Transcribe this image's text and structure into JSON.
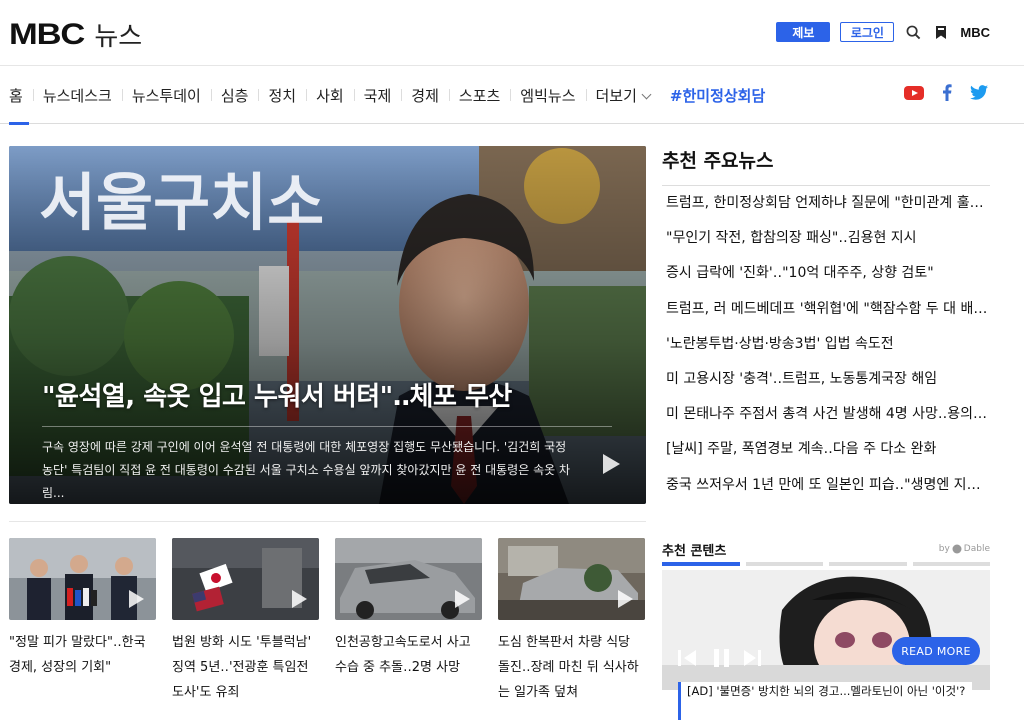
{
  "header": {
    "logo_brand": "MBC",
    "logo_section": "뉴스",
    "tip_button": "제보",
    "login_button": "로그인",
    "mbc_link": "MBC",
    "accent_color": "#2c63e8"
  },
  "nav": {
    "items": [
      {
        "label": "홈"
      },
      {
        "label": "뉴스데스크"
      },
      {
        "label": "뉴스투데이"
      },
      {
        "label": "심층"
      },
      {
        "label": "정치"
      },
      {
        "label": "사회"
      },
      {
        "label": "국제"
      },
      {
        "label": "경제"
      },
      {
        "label": "스포츠"
      },
      {
        "label": "엠빅뉴스"
      },
      {
        "label": "더보기"
      }
    ],
    "special_label": "#한미정상회담",
    "social": [
      "youtube-icon",
      "facebook-icon",
      "twitter-icon"
    ]
  },
  "hero": {
    "sign_text": "서울구치소",
    "title": "\"윤석열, 속옷 입고 누워서 버텨\"‥체포 무산",
    "description": "구속 영장에 따른 강제 구인에 이어 윤석열 전 대통령에 대한 체포영장 집행도 무산됐습니다. '김건희 국정농단' 특검팀이 직접 윤 전 대통령이 수감된 서울 구치소 수용실 앞까지 찾아갔지만 윤 전 대통령은 속옷 차림..."
  },
  "recommended_news": {
    "title": "추천 주요뉴스",
    "items": [
      "트럼프, 한미정상회담 언제하냐 질문에 \"한미관계 훌륭...",
      "\"무인기 작전, 합참의장 패싱\"‥김용현 지시",
      "증시 급락에 '진화'‥\"10억 대주주, 상향 검토\"",
      "트럼프, 러 메드베데프 '핵위협'에 \"핵잠수함 두 대 배치...",
      "'노란봉투법·상법·방송3법' 입법 속도전",
      "미 고용시장 '충격'‥트럼프, 노동통계국장 해임",
      "미 몬태나주 주점서 총격 사건 발생해 4명 사망‥용의자...",
      "[날씨] 주말, 폭염경보 계속‥다음 주 다소 완화",
      "중국 쓰저우서 1년 만에 또 일본인 피습‥\"생명엔 지장..."
    ]
  },
  "thumbnails": [
    {
      "caption": "\"정말 피가 말랐다\"‥한국 경제, 성장의 기회\""
    },
    {
      "caption": "법원 방화 시도 '투블럭남' 징역 5년‥'전광훈 특임전도사'도 유죄"
    },
    {
      "caption": "인천공항고속도로서 사고 수습 중 추돌‥2명 사망"
    },
    {
      "caption": "도심 한복판서 차량 식당 돌진‥장례 마친 뒤 식사하는 일가족 덮쳐"
    }
  ],
  "recommended_contents": {
    "title": "추천 콘텐츠",
    "by_label": "by",
    "provider": "Dable",
    "read_more": "READ MORE",
    "caption": "[AD] '불면증' 방치한 뇌의 경고...멜라토닌이 아닌 '이것'?"
  }
}
